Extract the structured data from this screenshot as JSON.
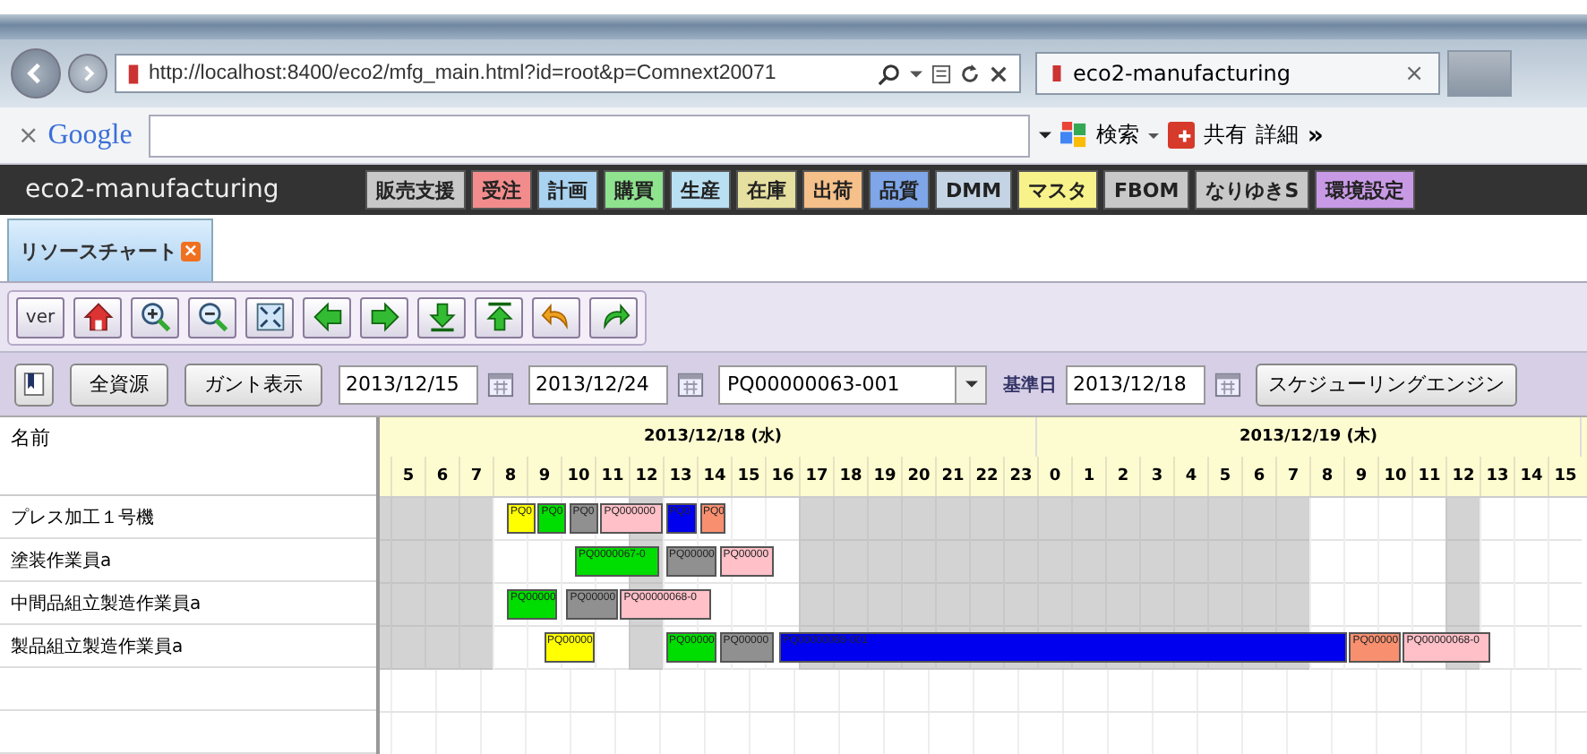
{
  "browser": {
    "address": "http://localhost:8400/eco2/mfg_main.html?id=root&p=Comnext20071",
    "tab": {
      "title": "eco2-manufacturing",
      "close": "×"
    }
  },
  "google_toolbar": {
    "close": "×",
    "logo": "Google",
    "search": "検索",
    "share": "共有",
    "more": "詳細",
    "chevron": "»"
  },
  "app": {
    "title": "eco2-manufacturing",
    "menu": [
      {
        "label": "販売支援",
        "color": "#c8c8c8"
      },
      {
        "label": "受注",
        "color": "#f28c8c"
      },
      {
        "label": "計画",
        "color": "#a9d3f0"
      },
      {
        "label": "購買",
        "color": "#8fe38f"
      },
      {
        "label": "生産",
        "color": "#b9dff2"
      },
      {
        "label": "在庫",
        "color": "#e6e0a0"
      },
      {
        "label": "出荷",
        "color": "#f5c08a"
      },
      {
        "label": "品質",
        "color": "#7ea6e8"
      },
      {
        "label": "DMM",
        "color": "#c4d4e4"
      },
      {
        "label": "マスタ",
        "color": "#f7f28a"
      },
      {
        "label": "FBOM",
        "color": "#c8c8c8"
      },
      {
        "label": "なりゆきS",
        "color": "#c8c8c8"
      },
      {
        "label": "環境設定",
        "color": "#c89ae6"
      }
    ]
  },
  "tabs": [
    {
      "label": "リソースチャート",
      "selected": true,
      "close": "×"
    }
  ],
  "toolbar": [
    {
      "kind": "text",
      "label": "ver"
    },
    {
      "kind": "home"
    },
    {
      "kind": "zoom-in"
    },
    {
      "kind": "zoom-out"
    },
    {
      "kind": "fit"
    },
    {
      "kind": "left"
    },
    {
      "kind": "right"
    },
    {
      "kind": "down"
    },
    {
      "kind": "up"
    },
    {
      "kind": "undo"
    },
    {
      "kind": "redo"
    }
  ],
  "filter": {
    "all_resources": "全資源",
    "gantt_view": "ガント表示",
    "from": "2013/12/15",
    "to": "2013/12/24",
    "order": "PQ00000063-001",
    "base_date_label": "基準日",
    "base_date": "2013/12/18",
    "engine": "スケジューリングエンジン"
  },
  "gantt": {
    "name_header": "名前",
    "days": [
      {
        "label": "2013/12/18 (水)",
        "hours": [
          {
            "label": "5",
            "working": false
          },
          {
            "label": "6",
            "working": false
          },
          {
            "label": "7",
            "working": false
          },
          {
            "label": "8",
            "working": true
          },
          {
            "label": "9",
            "working": true
          },
          {
            "label": "10",
            "working": true
          },
          {
            "label": "11",
            "working": true
          },
          {
            "label": "12",
            "working": false
          },
          {
            "label": "13",
            "working": true
          },
          {
            "label": "14",
            "working": true
          },
          {
            "label": "15",
            "working": true
          },
          {
            "label": "16",
            "working": true
          },
          {
            "label": "17",
            "working": false
          },
          {
            "label": "18",
            "working": false
          },
          {
            "label": "19",
            "working": false
          },
          {
            "label": "20",
            "working": false
          },
          {
            "label": "21",
            "working": false
          },
          {
            "label": "22",
            "working": false
          },
          {
            "label": "23",
            "working": false
          }
        ]
      },
      {
        "label": "2013/12/19 (木)",
        "hours": [
          {
            "label": "0",
            "working": false
          },
          {
            "label": "1",
            "working": false
          },
          {
            "label": "2",
            "working": false
          },
          {
            "label": "3",
            "working": false
          },
          {
            "label": "4",
            "working": false
          },
          {
            "label": "5",
            "working": false
          },
          {
            "label": "6",
            "working": false
          },
          {
            "label": "7",
            "working": false
          },
          {
            "label": "8",
            "working": true
          },
          {
            "label": "9",
            "working": true
          },
          {
            "label": "10",
            "working": true
          },
          {
            "label": "11",
            "working": true
          },
          {
            "label": "12",
            "working": false
          },
          {
            "label": "13",
            "working": true
          },
          {
            "label": "14",
            "working": true
          },
          {
            "label": "15",
            "working": true
          }
        ]
      }
    ],
    "rows": [
      {
        "name": "プレス加工１号機",
        "bars": [
          {
            "label": "PQ0",
            "color": "#ffff00"
          },
          {
            "label": "PQ0",
            "color": "#00dd00"
          },
          {
            "label": "PQ0",
            "color": "#909090"
          },
          {
            "label": "PQ000000",
            "color": "#ffc0c8"
          },
          {
            "label": "PQ0",
            "color": "#0000ee"
          },
          {
            "label": "PQ0",
            "color": "#f89070"
          }
        ]
      },
      {
        "name": "塗装作業員a",
        "bars": [
          {
            "label": "PQ0000067-0",
            "color": "#00dd00"
          },
          {
            "label": "PQ00000",
            "color": "#909090"
          },
          {
            "label": "PQ00000",
            "color": "#ffc0c8"
          }
        ]
      },
      {
        "name": "中間品組立製造作業員a",
        "bars": [
          {
            "label": "PQ00000",
            "color": "#00dd00"
          },
          {
            "label": "PQ00000",
            "color": "#909090"
          },
          {
            "label": "PQ00000068-0",
            "color": "#ffc0c8"
          }
        ]
      },
      {
        "name": "製品組立製造作業員a",
        "bars": [
          {
            "label": "PQ00000",
            "color": "#ffff00"
          },
          {
            "label": "PQ00000",
            "color": "#00dd00"
          },
          {
            "label": "PQ00000",
            "color": "#909090"
          },
          {
            "label": "PQ00000068-001",
            "color": "#0000ee"
          },
          {
            "label": "PQ00000",
            "color": "#f89070"
          },
          {
            "label": "PQ00000068-0",
            "color": "#ffc0c8"
          }
        ]
      }
    ]
  }
}
